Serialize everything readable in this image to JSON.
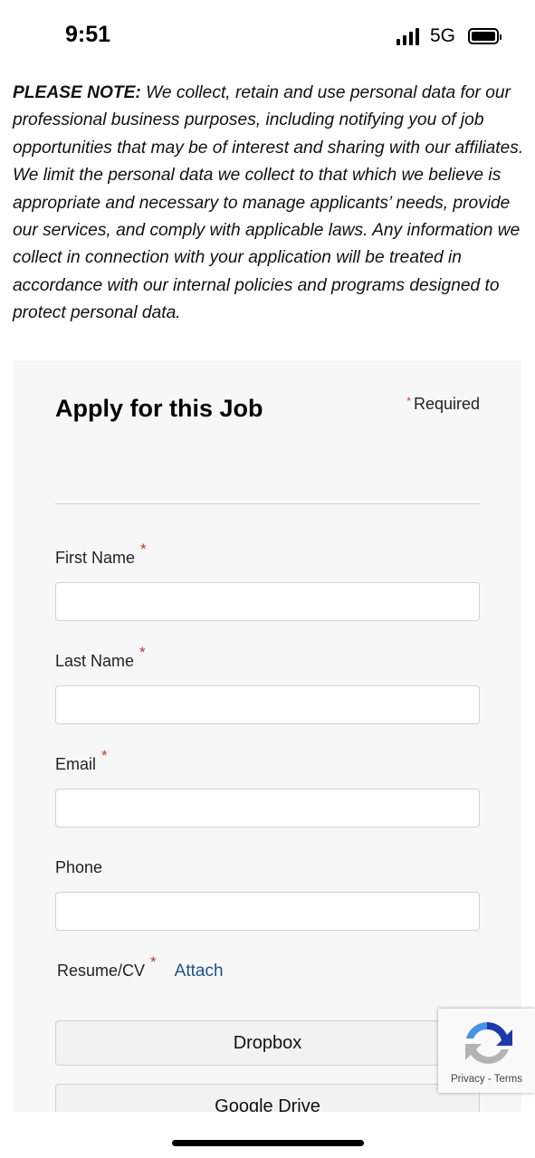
{
  "status_bar": {
    "time": "9:51",
    "network": "5G",
    "signal_bars": 4,
    "battery_level": 1.0
  },
  "notice": {
    "bold_prefix": "PLEASE NOTE:",
    "text": " We collect, retain and use personal data for our professional business purposes, including notifying you of job opportunities that may be of interest and sharing with our affiliates. We limit the personal data we collect to that which we believe is appropriate and necessary to manage applicants’ needs, provide our services, and comply with applicable laws. Any information we collect in connection with your application will be treated in accordance with our internal policies and programs designed to protect personal data."
  },
  "form": {
    "title": "Apply for this Job",
    "required_marker": "*",
    "required_label": "Required",
    "fields": {
      "first_name": {
        "label": "First Name",
        "value": ""
      },
      "last_name": {
        "label": "Last Name",
        "value": ""
      },
      "email": {
        "label": "Email",
        "value": ""
      },
      "phone": {
        "label": "Phone",
        "value": ""
      }
    },
    "resume": {
      "label": "Resume/CV",
      "attach_label": "Attach",
      "dropbox_label": "Dropbox",
      "google_drive_label": "Google Drive"
    }
  },
  "recaptcha": {
    "privacy_label": "Privacy",
    "separator": " - ",
    "terms_label": "Terms"
  },
  "colors": {
    "required_asterisk": "#c0392b",
    "link": "#1f4f8f",
    "panel_background": "#f7f7f7"
  }
}
